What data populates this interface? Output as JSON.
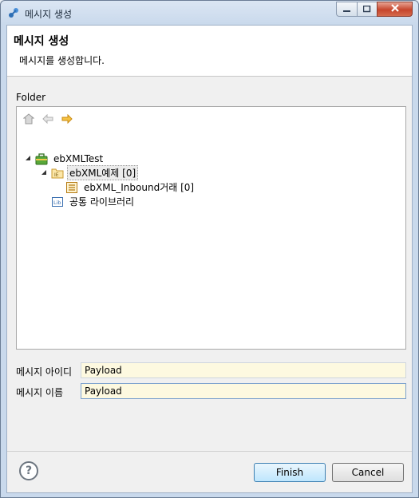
{
  "window": {
    "title": "메시지 생성"
  },
  "header": {
    "title": "메시지 생성",
    "description": "메시지를 생성합니다."
  },
  "folder": {
    "label": "Folder",
    "toolbar": [
      "home-icon",
      "back-arrow-icon",
      "forward-arrow-icon"
    ],
    "tree": {
      "project": "ebXMLTest",
      "folder": "ebXML예제 [0]",
      "item": "ebXML_Inbound거래 [0]",
      "library": "공통 라이브러리"
    }
  },
  "form": {
    "message_id_label": "메시지 아이디",
    "message_id_value": "Payload",
    "message_name_label": "메시지 이름",
    "message_name_value": "Payload"
  },
  "buttons": {
    "help": "?",
    "finish": "Finish",
    "cancel": "Cancel"
  },
  "colors": {
    "field_bg": "#fdf9e0",
    "finish_bg": "#bee6fd",
    "close_red": "#c6452c"
  }
}
